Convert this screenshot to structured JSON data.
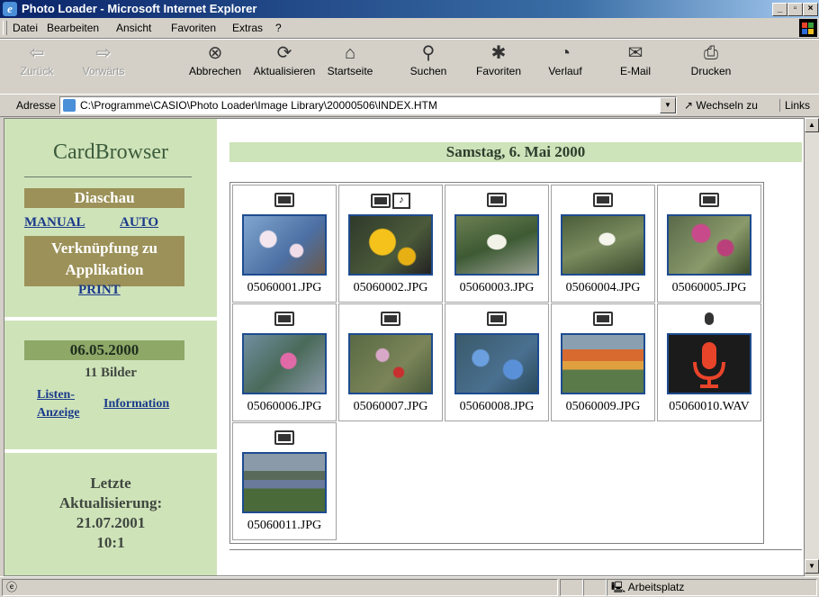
{
  "window": {
    "title": "Photo Loader - Microsoft Internet Explorer"
  },
  "menu": [
    "Datei",
    "Bearbeiten",
    "Ansicht",
    "Favoriten",
    "Extras",
    "?"
  ],
  "toolbar": {
    "back": "Zurück",
    "forward": "Vorwärts",
    "stop": "Abbrechen",
    "refresh": "Aktualisieren",
    "home": "Startseite",
    "search": "Suchen",
    "favorites": "Favoriten",
    "history": "Verlauf",
    "mail": "E-Mail",
    "print": "Drucken"
  },
  "address": {
    "label": "Adresse",
    "url": "C:\\Programme\\CASIO\\Photo Loader\\Image Library\\20000506\\INDEX.HTM",
    "go": "Wechseln zu",
    "links": "Links"
  },
  "sidebar": {
    "title": "CardBrowser",
    "slideshow": "Diaschau",
    "manual": "MANUAL",
    "auto": "AUTO",
    "app_link": "Verknüpfung zu Applikation",
    "print": "PRINT",
    "date": "06.05.2000",
    "count": "11 Bilder",
    "list_view": "Listen-Anzeige",
    "information": "Information",
    "last_update_label": "Letzte Aktualisierung:",
    "last_update_date": "21.07.2001",
    "last_update_time": "10:1"
  },
  "main": {
    "date_header": "Samstag, 6. Mai 2000",
    "items": [
      {
        "file": "05060001.JPG",
        "type": "image"
      },
      {
        "file": "05060002.JPG",
        "type": "image+audio"
      },
      {
        "file": "05060003.JPG",
        "type": "image"
      },
      {
        "file": "05060004.JPG",
        "type": "image"
      },
      {
        "file": "05060005.JPG",
        "type": "image"
      },
      {
        "file": "05060006.JPG",
        "type": "image"
      },
      {
        "file": "05060007.JPG",
        "type": "image"
      },
      {
        "file": "05060008.JPG",
        "type": "image"
      },
      {
        "file": "05060009.JPG",
        "type": "image"
      },
      {
        "file": "05060010.WAV",
        "type": "audio"
      },
      {
        "file": "05060011.JPG",
        "type": "image"
      }
    ]
  },
  "status": {
    "zone": "Arbeitsplatz"
  },
  "colors": {
    "sidebar_bg": "#cfe3b9",
    "olive_band": "#9c9158",
    "link": "#1a3a8a",
    "title_bar": "#0a246a",
    "wav_bg": "#1b1b1b",
    "mic": "#e8442a"
  }
}
